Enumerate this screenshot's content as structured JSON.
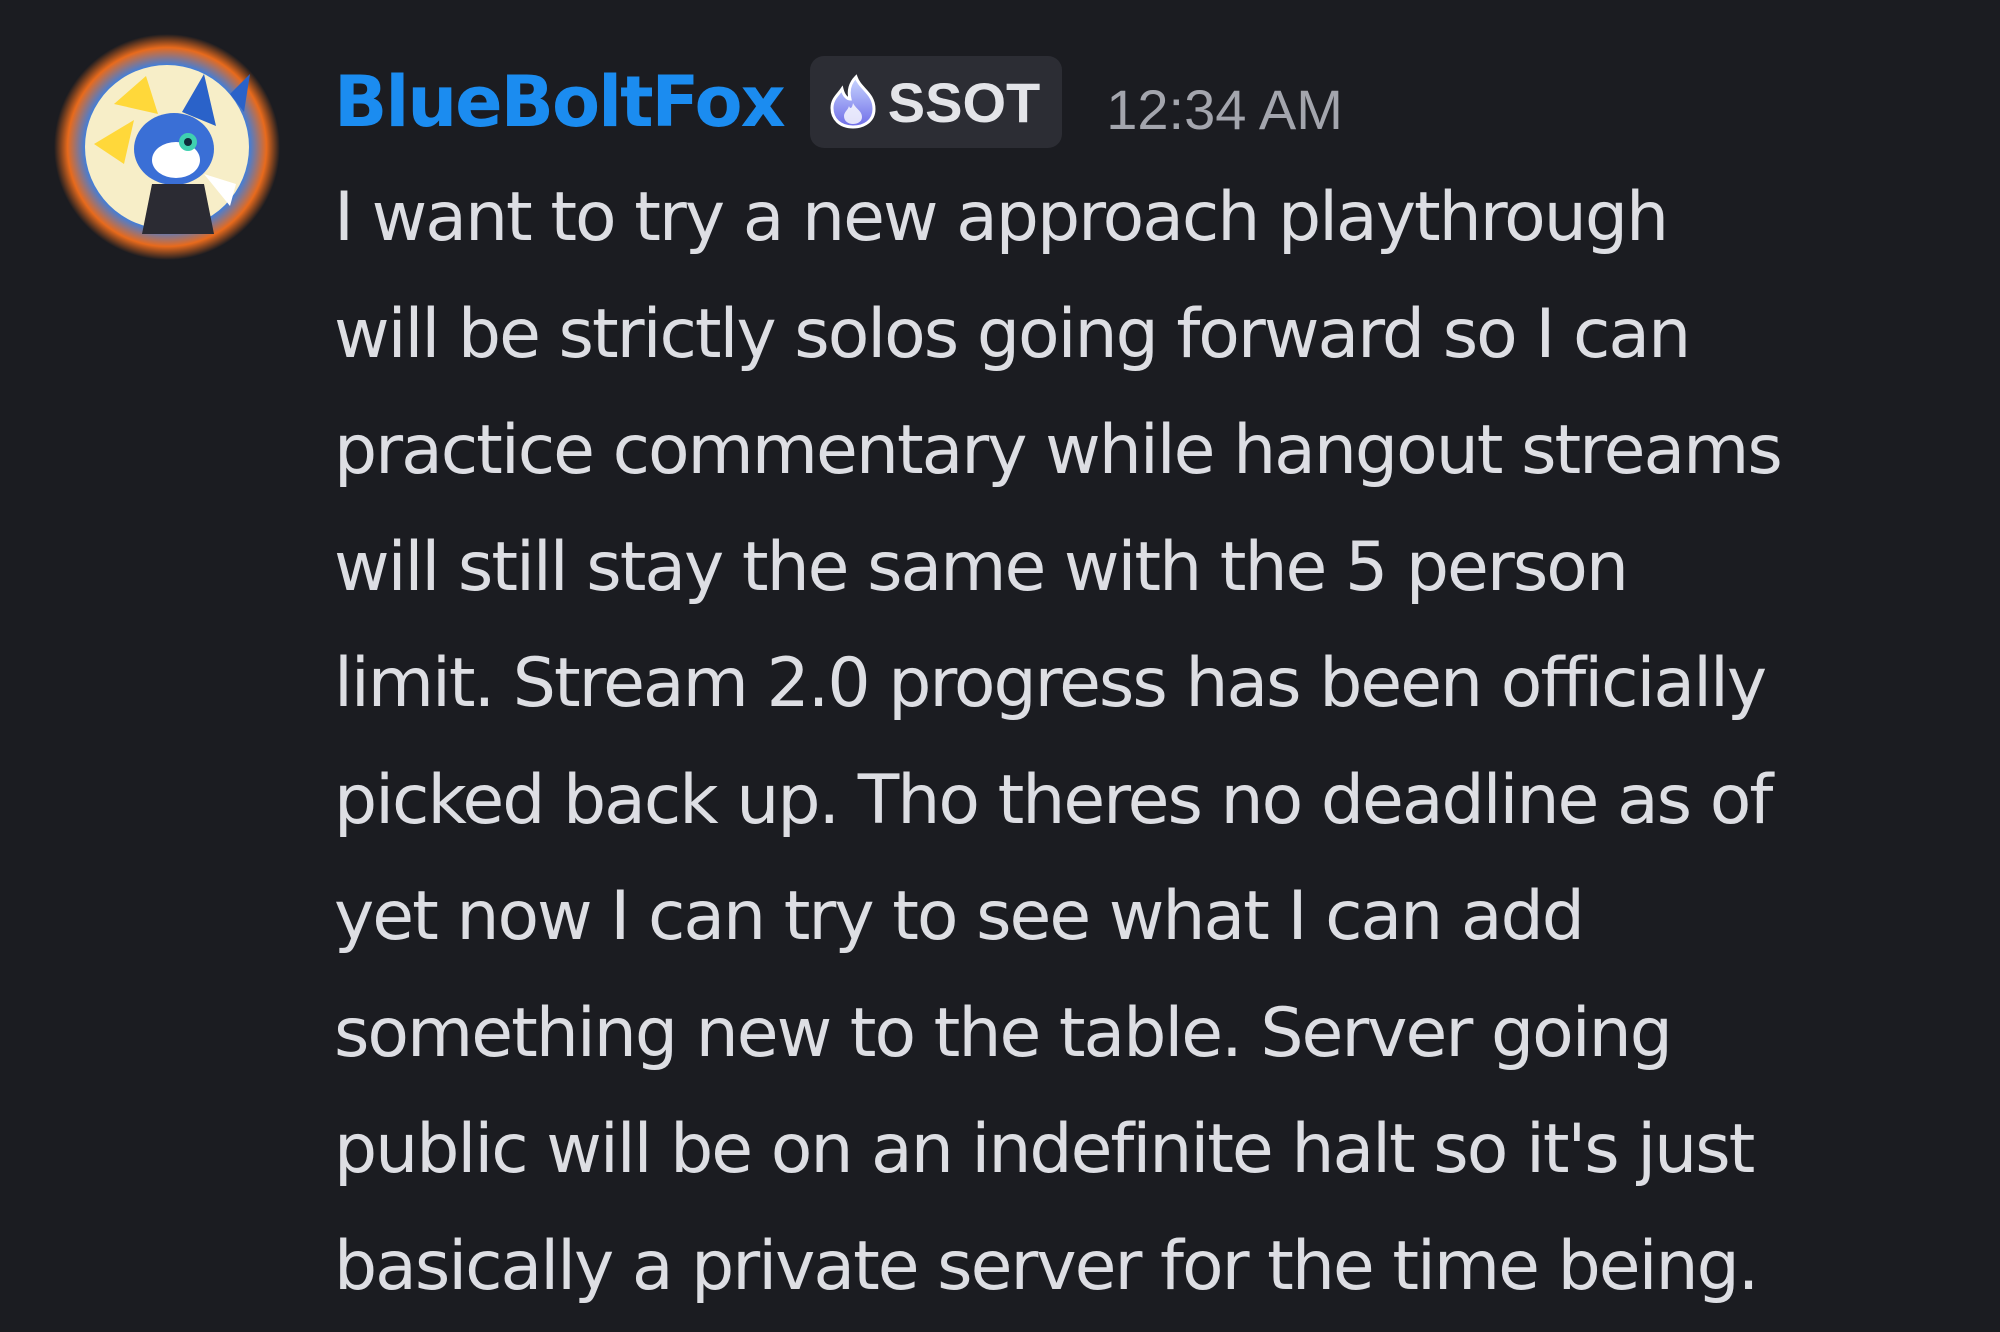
{
  "message": {
    "author": {
      "username": "BlueBoltFox",
      "username_color": "#1b8cf0",
      "avatar_icon": "fox-avatar-icon"
    },
    "server_tag": {
      "icon": "flame-icon",
      "label": "SSOT"
    },
    "timestamp": "12:34 AM",
    "lines": [
      "I want to try a new approach playthrough",
      "will be strictly solos going forward so I can",
      "practice commentary while hangout streams",
      "will still stay the same with the 5 person",
      "limit. Stream 2.0 progress has been officially",
      "picked back up. Tho theres no deadline as of",
      "yet now I can try to see what I can add",
      "something new to the table. Server going",
      "public will be on an indefinite halt so it's just",
      "basically a private server for the time being."
    ]
  },
  "colors": {
    "background": "#1b1c21",
    "text": "#dddee3",
    "timestamp": "#a3a5ad",
    "tag_background": "#2c2d34"
  }
}
